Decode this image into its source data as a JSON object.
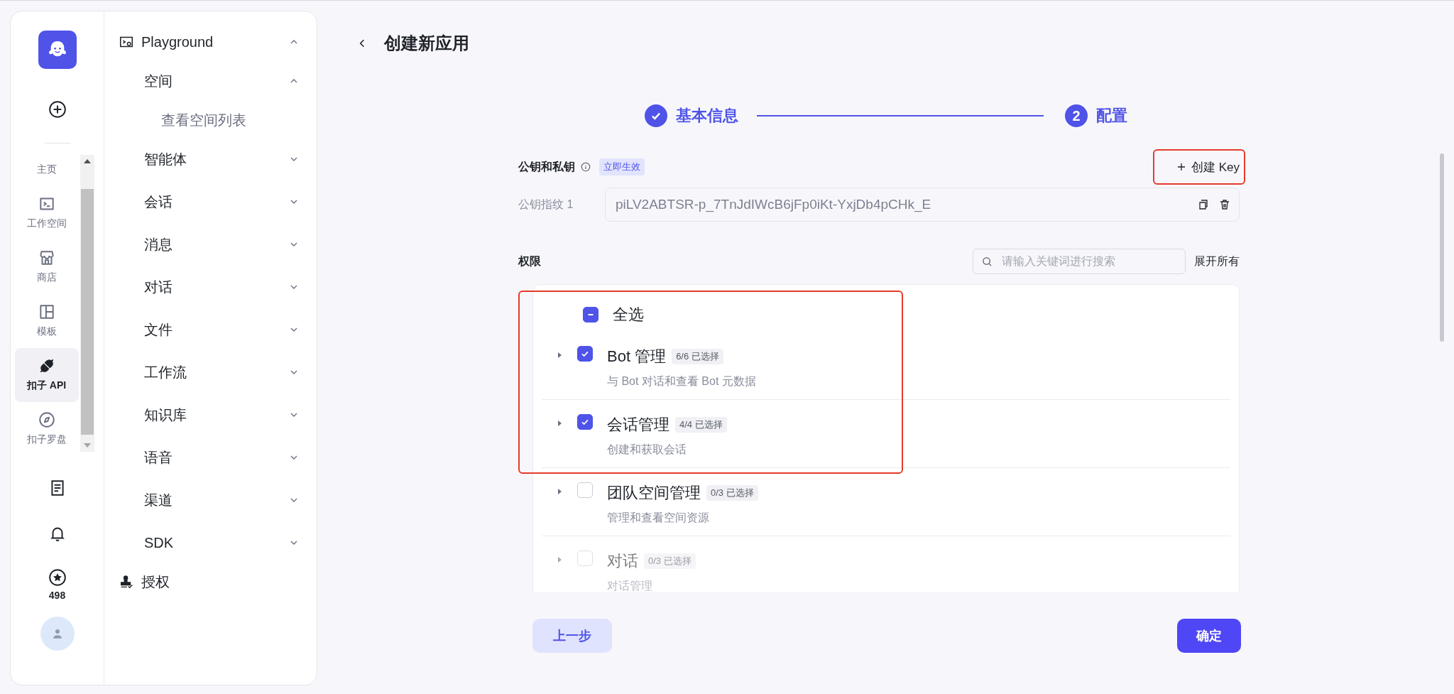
{
  "rail": {
    "items": [
      {
        "label": "主页",
        "kind": "home",
        "selected": false
      },
      {
        "label": "工作空间",
        "kind": "workspace",
        "selected": false
      },
      {
        "label": "商店",
        "kind": "store",
        "selected": false
      },
      {
        "label": "模板",
        "kind": "template",
        "selected": false
      },
      {
        "label": "扣子 API",
        "kind": "api",
        "selected": true
      },
      {
        "label": "扣子罗盘",
        "kind": "compass",
        "selected": false
      }
    ],
    "points": "498"
  },
  "sidebar": {
    "items": [
      {
        "label": "Playground",
        "kind": "group",
        "expanded": true,
        "children": [
          {
            "label": "空间",
            "expanded": true,
            "children": [
              {
                "label": "查看空间列表"
              }
            ]
          },
          {
            "label": "智能体",
            "expanded": false
          },
          {
            "label": "会话",
            "expanded": false
          },
          {
            "label": "消息",
            "expanded": false
          },
          {
            "label": "对话",
            "expanded": false
          },
          {
            "label": "文件",
            "expanded": false
          },
          {
            "label": "工作流",
            "expanded": false
          },
          {
            "label": "知识库",
            "expanded": false
          },
          {
            "label": "语音",
            "expanded": false
          },
          {
            "label": "渠道",
            "expanded": false
          },
          {
            "label": "SDK",
            "expanded": false
          }
        ]
      },
      {
        "label": "授权",
        "kind": "link"
      }
    ]
  },
  "page": {
    "title": "创建新应用"
  },
  "steps": [
    {
      "label": "基本信息",
      "done": true
    },
    {
      "label": "配置",
      "done": false,
      "number": "2"
    }
  ],
  "keys": {
    "label": "公钥和私钥",
    "badge": "立即生效",
    "create_button": "创建 Key",
    "fingerprints": [
      {
        "label": "公钥指纹 1",
        "value": "piLV2ABTSR-p_7TnJdIWcB6jFp0iKt-YxjDb4pCHk_E"
      }
    ]
  },
  "permissions": {
    "label": "权限",
    "search": {
      "placeholder": "请输入关键词进行搜索"
    },
    "expand_all": "展开所有",
    "select_all": {
      "label": "全选",
      "indeterminate": true
    },
    "items": [
      {
        "name": "Bot 管理",
        "count": "6/6 已选择",
        "description": "与 Bot 对话和查看 Bot 元数据",
        "checked": true,
        "expanded": false
      },
      {
        "name": "会话管理",
        "count": "4/4 已选择",
        "description": "创建和获取会话",
        "checked": true,
        "expanded": false
      },
      {
        "name": "团队空间管理",
        "count": "0/3 已选择",
        "description": "管理和查看空间资源",
        "checked": false,
        "expanded": false
      },
      {
        "name": "对话",
        "count": "0/3 已选择",
        "description": "对话管理",
        "checked": false,
        "expanded": false
      }
    ]
  },
  "buttons": {
    "back": "上一步",
    "confirm": "确定"
  }
}
